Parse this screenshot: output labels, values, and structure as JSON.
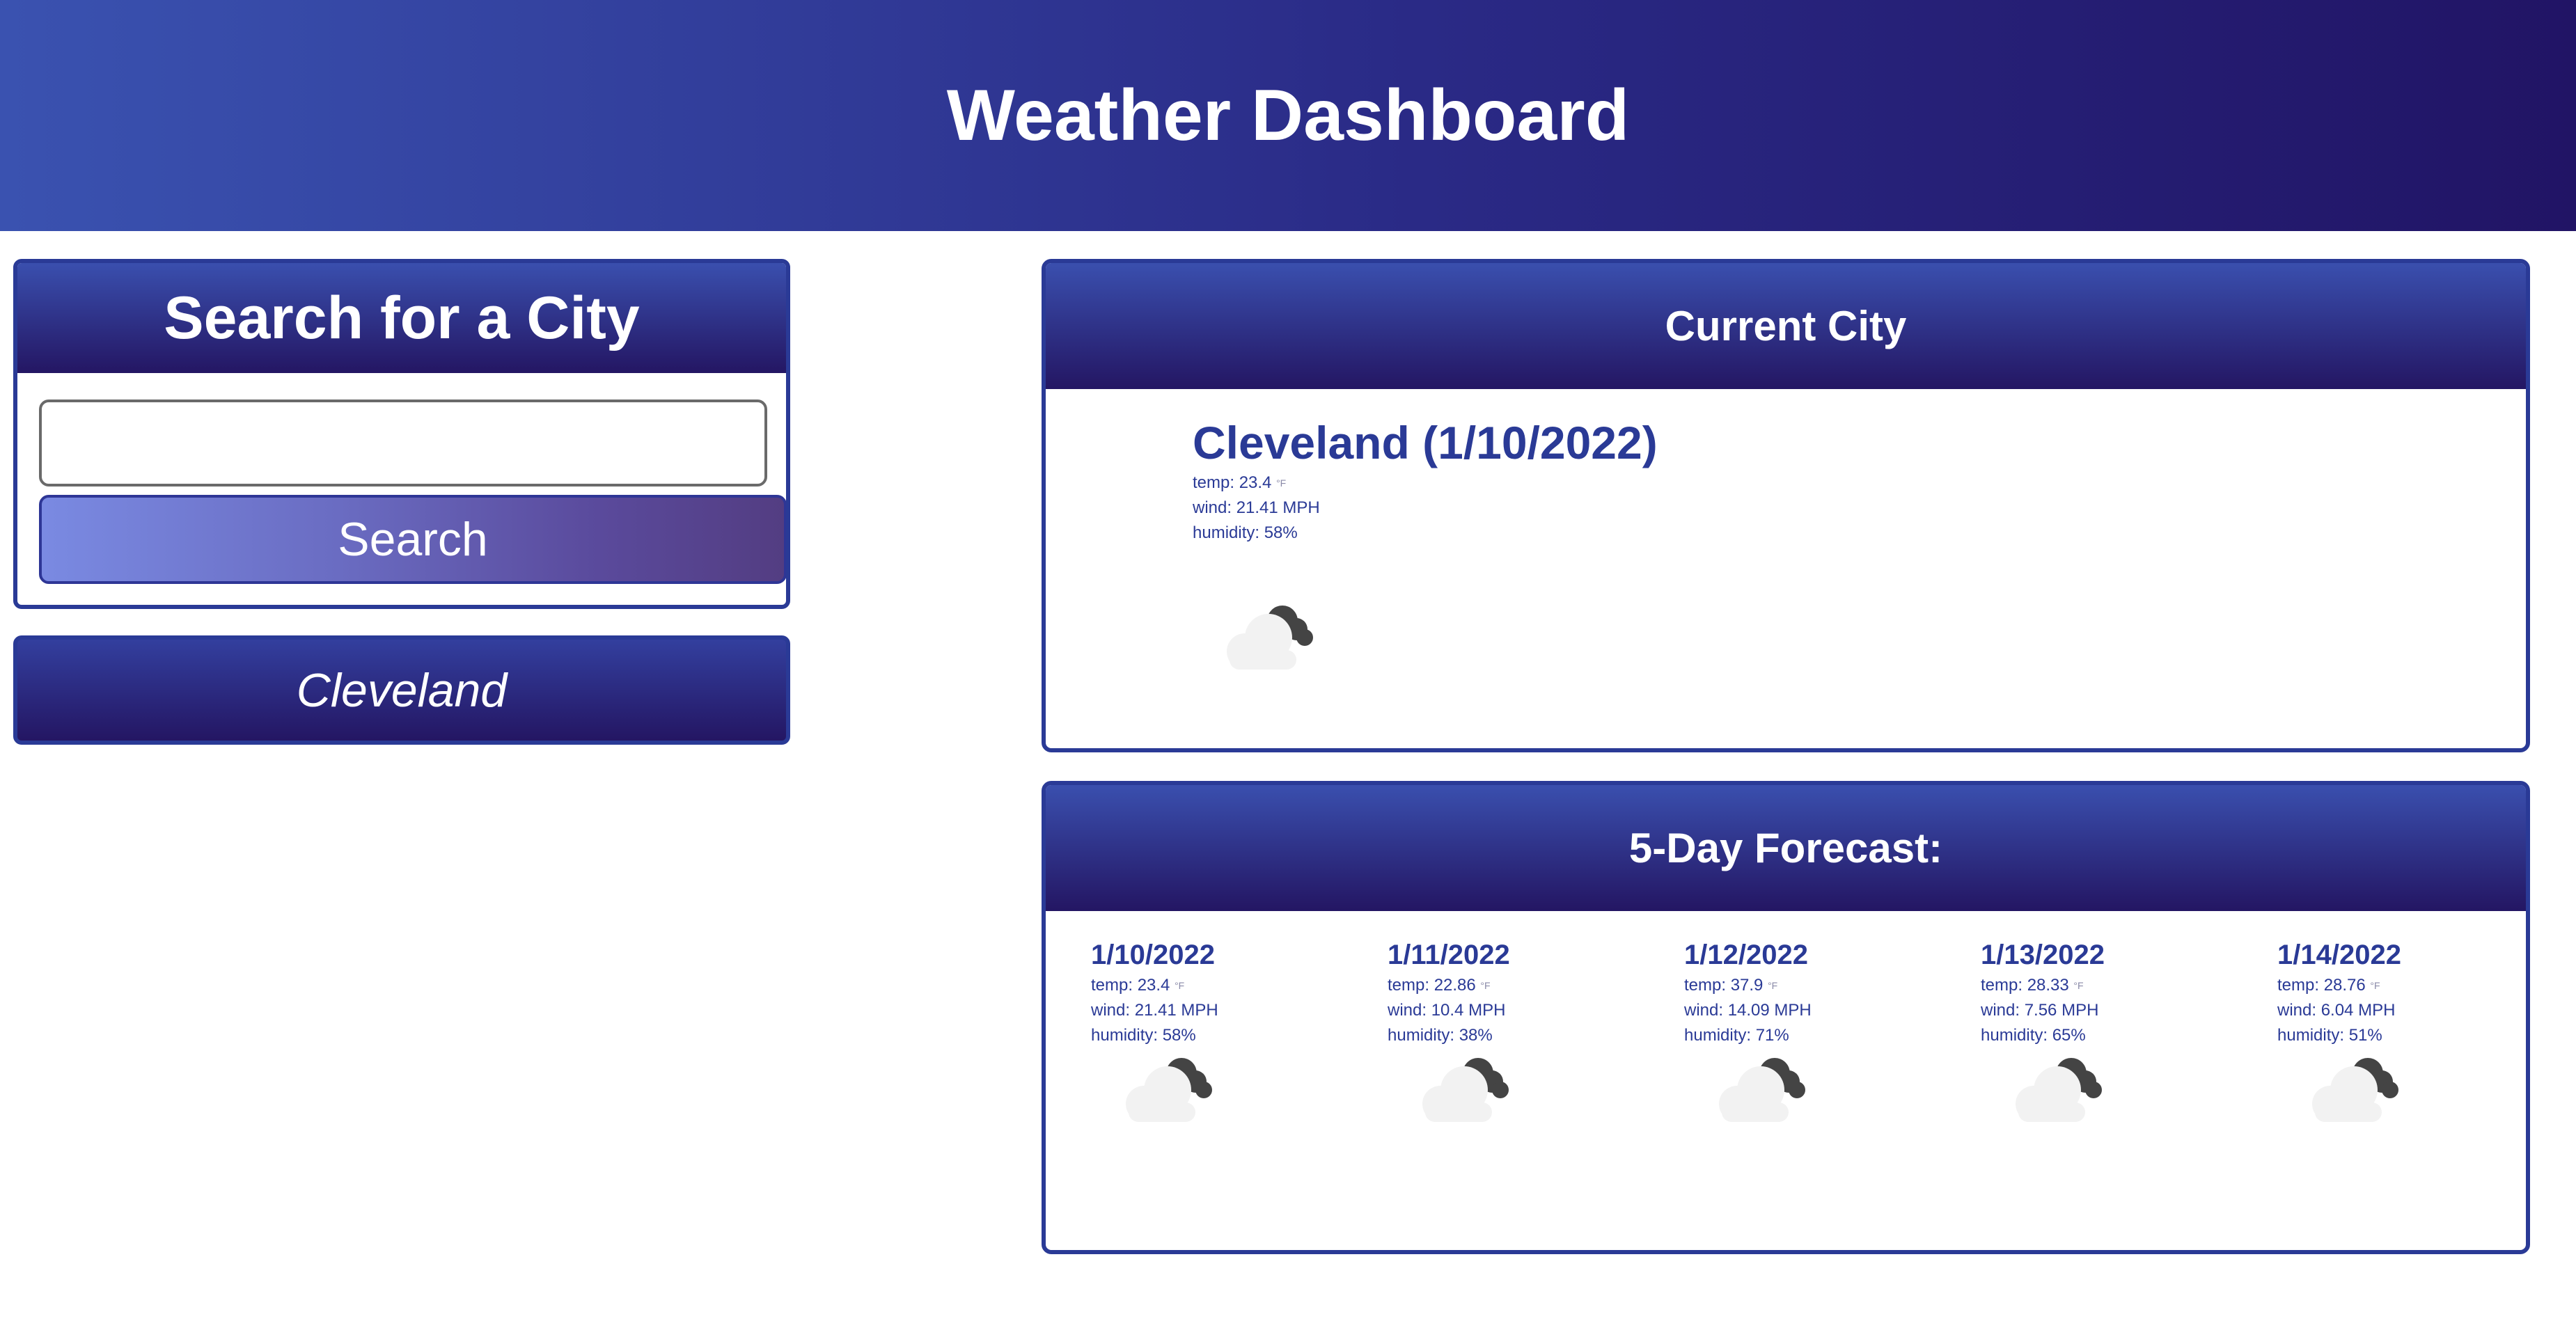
{
  "header": {
    "title": "Weather Dashboard"
  },
  "search": {
    "title": "Search for a City",
    "input_value": "",
    "placeholder": "",
    "button_label": "Search"
  },
  "history": {
    "items": [
      {
        "label": "Cleveland"
      }
    ]
  },
  "current": {
    "section_title": "Current City",
    "heading": "Cleveland (1/10/2022)",
    "temp": "temp: 23.4",
    "wind": "wind: 21.41 MPH",
    "humidity": "humidity: 58%",
    "icon": "partly-cloudy-night-icon"
  },
  "forecast": {
    "section_title": "5-Day Forecast:",
    "days": [
      {
        "date": "1/10/2022",
        "temp": "temp: 23.4",
        "wind": "wind: 21.41 MPH",
        "humidity": "humidity: 58%",
        "icon": "partly-cloudy-night-icon"
      },
      {
        "date": "1/11/2022",
        "temp": "temp: 22.86",
        "wind": "wind: 10.4 MPH",
        "humidity": "humidity: 38%",
        "icon": "partly-cloudy-night-icon"
      },
      {
        "date": "1/12/2022",
        "temp": "temp: 37.9",
        "wind": "wind: 14.09 MPH",
        "humidity": "humidity: 71%",
        "icon": "partly-cloudy-night-icon"
      },
      {
        "date": "1/13/2022",
        "temp": "temp: 28.33",
        "wind": "wind: 7.56 MPH",
        "humidity": "humidity: 65%",
        "icon": "partly-cloudy-night-icon"
      },
      {
        "date": "1/14/2022",
        "temp": "temp: 28.76",
        "wind": "wind: 6.04 MPH",
        "humidity": "humidity: 51%",
        "icon": "partly-cloudy-night-icon"
      }
    ]
  },
  "colors": {
    "primary": "#2a3a96",
    "header_start": "#3a52b0",
    "header_end": "#211465",
    "button_start": "#7a8ae2",
    "button_end": "#533d82"
  }
}
